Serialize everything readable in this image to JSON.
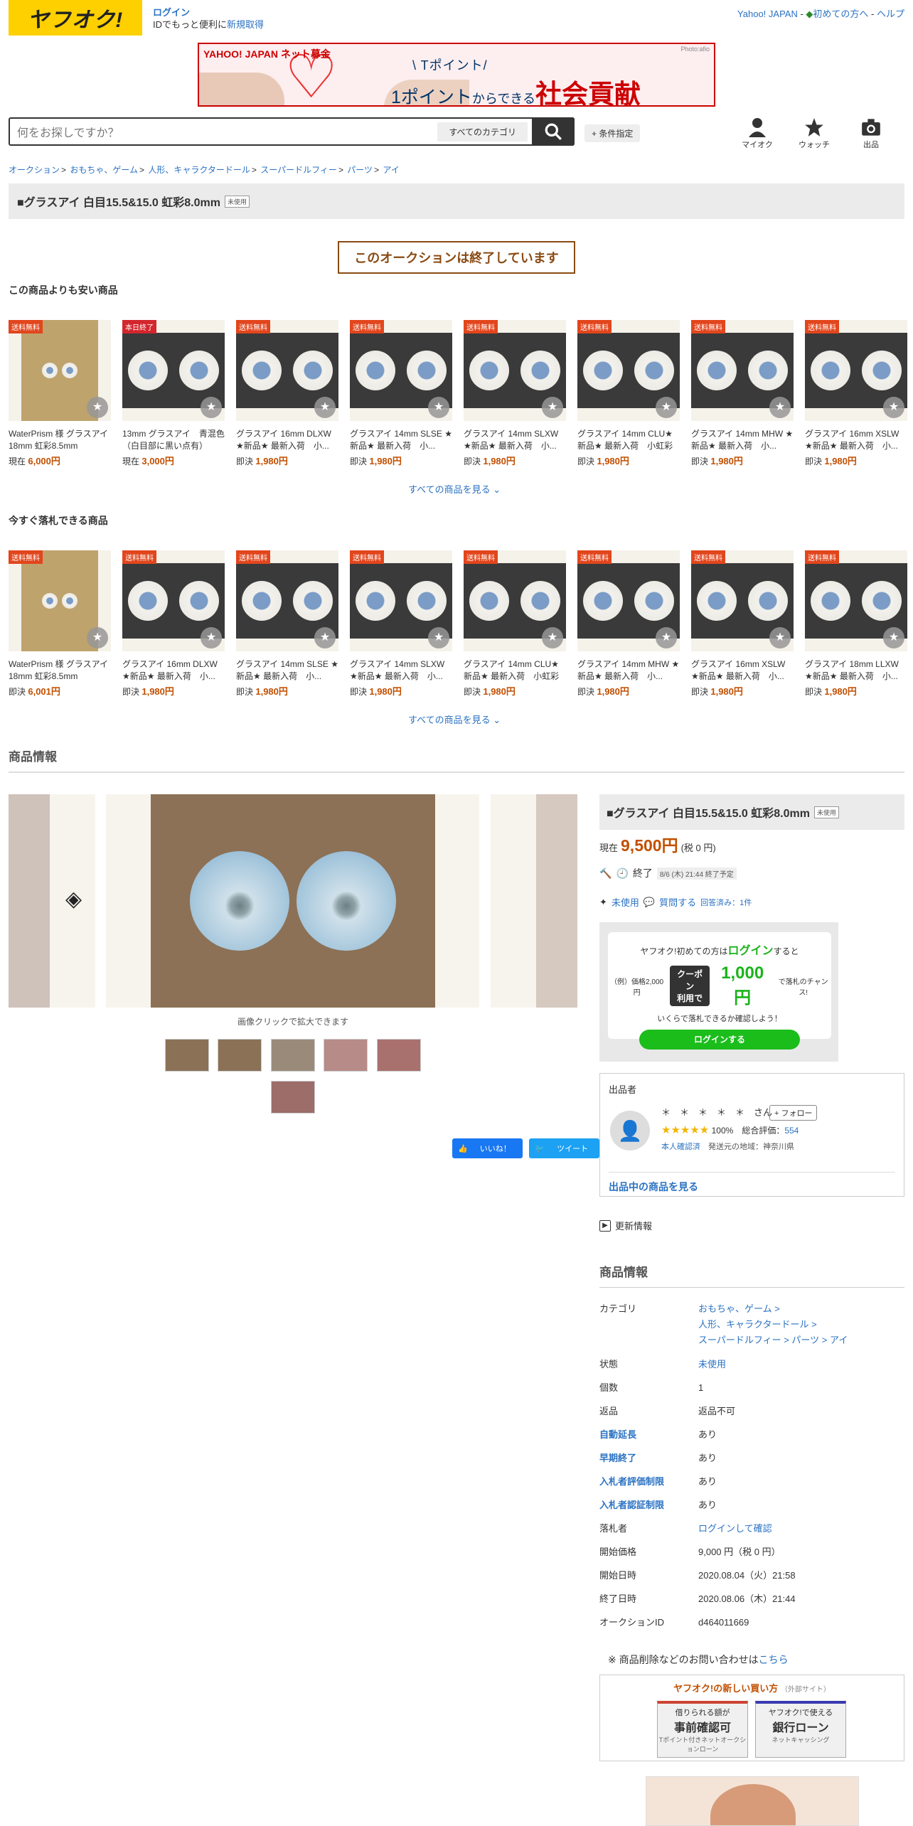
{
  "header": {
    "logo": "ヤフオク!",
    "login": "ログイン",
    "login_sub": "IDでもっと便利に",
    "register": "新規取得",
    "toplinks": [
      "Yahoo! JAPAN",
      "初めての方へ",
      "ヘルプ"
    ]
  },
  "banner": {
    "brand": "YAHOO! JAPAN ネット募金",
    "credit": "Photo:afio",
    "line1": "\\ Tポイント/",
    "line2_a": "1ポイント",
    "line2_b": "からできる",
    "line2_c": "社会貢献"
  },
  "search": {
    "placeholder": "何をお探しですか？",
    "category": "すべてのカテゴリ",
    "conditions": "+ 条件指定"
  },
  "nav_icons": [
    {
      "label": "マイオク"
    },
    {
      "label": "ウォッチ"
    },
    {
      "label": "出品"
    }
  ],
  "breadcrumb": [
    "オークション",
    "おもちゃ、ゲーム",
    "人形、キャラクタードール",
    "スーパードルフィー",
    "パーツ",
    "アイ"
  ],
  "title": "■グラスアイ 白目15.5&15.0 虹彩8.0mm",
  "title_badge": "未使用",
  "ended": "このオークションは終了しています",
  "cheaper": {
    "heading": "この商品よりも安い商品",
    "more": "すべての商品を見る",
    "items": [
      {
        "tag": "送料無料",
        "name": "WaterPrism 様 グラスアイ 18mm 虹彩8.5mm",
        "plabel": "現在",
        "price": "6,000円"
      },
      {
        "tag": "本日終了",
        "name": "13mm グラスアイ　青混色（白目部に黒い点有）",
        "plabel": "現在",
        "price": "3,000円"
      },
      {
        "tag": "送料無料",
        "name": "グラスアイ 16mm DLXW ★新品★ 最新入荷　小...",
        "plabel": "即決",
        "price": "1,980円"
      },
      {
        "tag": "送料無料",
        "name": "グラスアイ 14mm SLSE ★新品★ 最新入荷　小...",
        "plabel": "即決",
        "price": "1,980円"
      },
      {
        "tag": "送料無料",
        "name": "グラスアイ 14mm SLXW ★新品★ 最新入荷　小...",
        "plabel": "即決",
        "price": "1,980円"
      },
      {
        "tag": "送料無料",
        "name": "グラスアイ 14mm CLU★新品★ 最新入荷　小虹彩",
        "plabel": "即決",
        "price": "1,980円"
      },
      {
        "tag": "送料無料",
        "name": "グラスアイ 14mm MHW ★新品★ 最新入荷　小...",
        "plabel": "即決",
        "price": "1,980円"
      },
      {
        "tag": "送料無料",
        "name": "グラスアイ 16mm XSLW ★新品★ 最新入荷　小...",
        "plabel": "即決",
        "price": "1,980円"
      }
    ]
  },
  "buynow": {
    "heading": "今すぐ落札できる商品",
    "more": "すべての商品を見る",
    "items": [
      {
        "tag": "送料無料",
        "name": "WaterPrism 様 グラスアイ 18mm 虹彩8.5mm",
        "plabel": "即決",
        "price": "6,001円"
      },
      {
        "tag": "送料無料",
        "name": "グラスアイ 16mm DLXW ★新品★ 最新入荷　小...",
        "plabel": "即決",
        "price": "1,980円"
      },
      {
        "tag": "送料無料",
        "name": "グラスアイ 14mm SLSE ★新品★ 最新入荷　小...",
        "plabel": "即決",
        "price": "1,980円"
      },
      {
        "tag": "送料無料",
        "name": "グラスアイ 14mm SLXW ★新品★ 最新入荷　小...",
        "plabel": "即決",
        "price": "1,980円"
      },
      {
        "tag": "送料無料",
        "name": "グラスアイ 14mm CLU★新品★ 最新入荷　小虹彩",
        "plabel": "即決",
        "price": "1,980円"
      },
      {
        "tag": "送料無料",
        "name": "グラスアイ 14mm MHW ★新品★ 最新入荷　小...",
        "plabel": "即決",
        "price": "1,980円"
      },
      {
        "tag": "送料無料",
        "name": "グラスアイ 16mm XSLW ★新品★ 最新入荷　小...",
        "plabel": "即決",
        "price": "1,980円"
      },
      {
        "tag": "送料無料",
        "name": "グラスアイ 18mm LLXW ★新品★ 最新入荷　小...",
        "plabel": "即決",
        "price": "1,980円"
      }
    ]
  },
  "section_info": "商品情報",
  "gallery": {
    "caption": "画像クリックで拡大できます",
    "like": "いいね！",
    "tweet": "ツイート"
  },
  "price": {
    "label": "現在",
    "value": "9,500円",
    "tax": "(税 0 円)"
  },
  "end": {
    "label": "終了",
    "date": "8/6 (木) 21:44 終了予定"
  },
  "cond": {
    "state": "未使用",
    "question": "質問する",
    "answered": "回答済み：1件"
  },
  "promo": {
    "l1a": "ヤフオク!初めての方は",
    "l1b": "ログイン",
    "l1c": "すると",
    "ex": "（例）価格2,000円",
    "coupon_a": "クーポン",
    "coupon_b": "利用で",
    "amount": "1,000円",
    "suffix": "で落札のチャンス!",
    "l3": "いくらで落札できるか確認しよう！",
    "button": "ログインする"
  },
  "seller": {
    "heading": "出品者",
    "name": "＊　＊　＊　＊　＊　さん",
    "follow": "+ フォロー",
    "stars": "★★★★★",
    "pct": "100%",
    "total_label": "総合評価：",
    "total": "554",
    "verified": "本人確認済",
    "region": "発送元の地域：神奈川県",
    "listing": "出品中の商品を見る"
  },
  "update": "更新情報",
  "info_heading": "商品情報",
  "info": [
    {
      "k": "カテゴリ",
      "v": "おもちゃ、ゲーム > ",
      "v2": "人形、キャラクタードール > ",
      "v3": "スーパードルフィー > パーツ > アイ",
      "link": true
    },
    {
      "k": "状態",
      "v": "未使用",
      "link": true
    },
    {
      "k": "個数",
      "v": "1"
    },
    {
      "k": "返品",
      "v": "返品不可"
    },
    {
      "k": "自動延長",
      "v": "あり",
      "bold": true
    },
    {
      "k": "早期終了",
      "v": "あり",
      "bold": true
    },
    {
      "k": "入札者評価制限",
      "v": "あり",
      "bold": true
    },
    {
      "k": "入札者認証制限",
      "v": "あり",
      "bold": true
    },
    {
      "k": "落札者",
      "v": "ログインして確認",
      "link": true
    },
    {
      "k": "開始価格",
      "v": "9,000 円（税 0 円）"
    },
    {
      "k": "開始日時",
      "v": "2020.08.04（火）21:58"
    },
    {
      "k": "終了日時",
      "v": "2020.08.06（木）21:44"
    },
    {
      "k": "オークションID",
      "v": "d464011669"
    }
  ],
  "note": {
    "a": "※ 商品削除などのお問い合わせは",
    "b": "こちら"
  },
  "buybox": {
    "heading": "ヤフオク!の新しい買い方",
    "heading_sub": "（外部サイト）",
    "t1_top": "借りられる額が",
    "t1_main": "事前確認可",
    "t1_sub": "Tポイント付きネットオークションローン",
    "t2_top": "ヤフオク!で使える",
    "t2_main": "銀行ローン",
    "t2_sub": "ネットキャッシング"
  },
  "colors": {
    "accent": "#ffd000",
    "price": "#c24f00",
    "link": "#2b72c2",
    "green": "#1bbd1b"
  }
}
